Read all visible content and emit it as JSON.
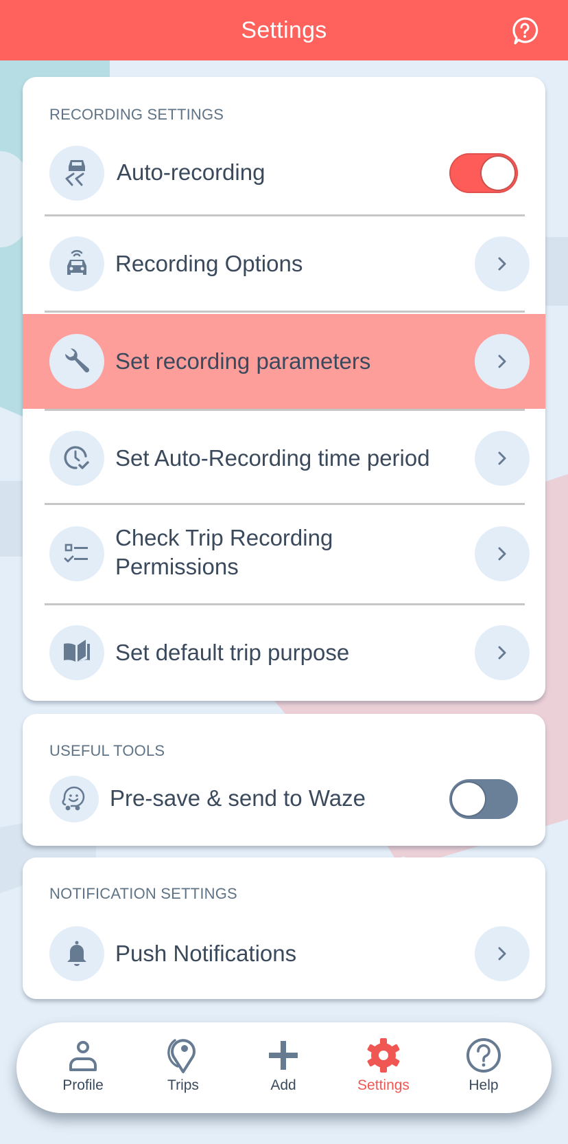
{
  "header": {
    "title": "Settings",
    "help_icon": "help-bubble-icon"
  },
  "colors": {
    "header_bg": "#ff625c",
    "highlight_row": "#fe9e9b",
    "toggle_on": "#fd5c58",
    "toggle_off": "#6a8099",
    "active_nav": "#f05652",
    "text": "#3a4a5c",
    "icon_bg": "#e3edf8"
  },
  "recording_settings": {
    "section_label": "RECORDING SETTINGS",
    "auto_recording": {
      "label": "Auto-recording",
      "icon": "car-skid-icon",
      "toggle_on": true
    },
    "items": [
      {
        "label": "Recording Options",
        "icon": "connected-car-icon"
      },
      {
        "label": "Set recording parameters",
        "icon": "wrench-icon",
        "highlighted": true
      },
      {
        "label": "Set Auto-Recording time period",
        "icon": "clock-check-icon"
      },
      {
        "label_line1": "Check Trip Recording",
        "label_line2": "Permissions",
        "icon": "checklist-icon"
      },
      {
        "label": "Set default trip purpose",
        "icon": "book-icon"
      }
    ]
  },
  "useful_tools": {
    "section_label": "USEFUL TOOLS",
    "waze": {
      "label": "Pre-save & send to Waze",
      "icon": "waze-icon",
      "toggle_on": false
    }
  },
  "notification_settings": {
    "section_label": "NOTIFICATION SETTINGS",
    "push": {
      "label": "Push Notifications",
      "icon": "bell-icon"
    }
  },
  "bottom_nav": {
    "items": [
      {
        "label": "Profile",
        "icon": "person-icon"
      },
      {
        "label": "Trips",
        "icon": "map-pin-icon"
      },
      {
        "label": "Add",
        "icon": "plus-icon"
      },
      {
        "label": "Settings",
        "icon": "gear-icon",
        "active": true
      },
      {
        "label": "Help",
        "icon": "question-circle-icon"
      }
    ]
  }
}
